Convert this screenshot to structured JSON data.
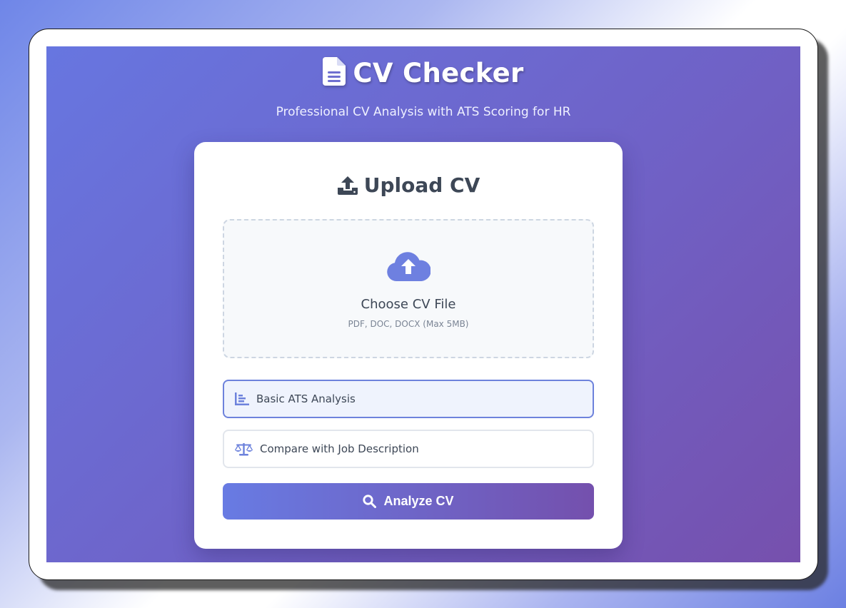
{
  "app": {
    "title": "CV Checker",
    "subtitle": "Professional CV Analysis with ATS Scoring for HR",
    "title_icon": "file-text-icon"
  },
  "upload_card": {
    "title": "Upload CV",
    "title_icon": "upload-icon",
    "dropzone": {
      "icon": "cloud-upload-icon",
      "title": "Choose CV File",
      "formats": "PDF, DOC, DOCX (Max 5MB)"
    },
    "options": [
      {
        "label": "Basic ATS Analysis",
        "icon": "bar-chart-icon",
        "selected": true
      },
      {
        "label": "Compare with Job Description",
        "icon": "balance-scale-icon",
        "selected": false
      }
    ],
    "analyze_button": {
      "label": "Analyze CV",
      "icon": "search-icon"
    }
  },
  "colors": {
    "accent": "#6d82dc",
    "gradient_start": "#667eea",
    "gradient_end": "#764ba2",
    "text_dark": "#3d4756"
  }
}
